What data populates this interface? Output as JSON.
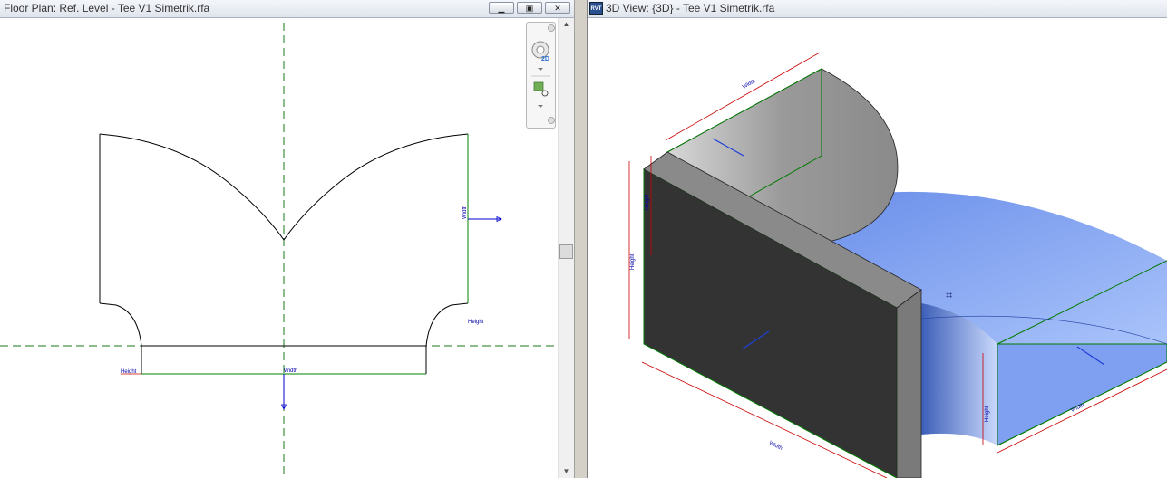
{
  "left_view": {
    "title": "Floor Plan: Ref. Level - Tee V1 Simetrik.rfa",
    "window_buttons": {
      "minimize": "▁",
      "restore": "▣",
      "close": "✕"
    },
    "dimension_labels": {
      "width_right": "Width",
      "width_bottom": "Width",
      "height_right": "Height",
      "height_left": "Height"
    },
    "navbar": {
      "wheel_icon": "steering-wheel-icon",
      "zoom_icon": "zoom-region-icon",
      "wheel_badge": "2D"
    }
  },
  "right_view": {
    "title": "3D View: {3D} - Tee V1 Simetrik.rfa",
    "app_badge": "RVT",
    "dimension_labels": {
      "width_top": "Width",
      "height_inner": "Height",
      "height_outer": "Height",
      "width_front": "Width",
      "height_branch": "Height",
      "width_branch": "Width"
    },
    "colors": {
      "dark_face": "#333333",
      "grey_face": "#8a8a8a",
      "blue_face": "#7fa3f5",
      "edge_green": "#007a00",
      "dim_red": "#cc0000"
    }
  }
}
